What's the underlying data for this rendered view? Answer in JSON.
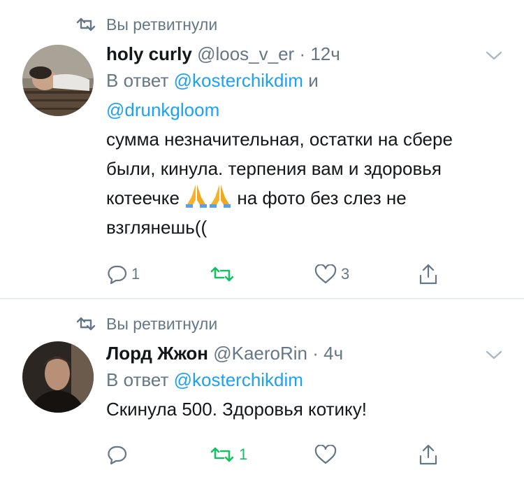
{
  "tweets": [
    {
      "retweet_label": "Вы ретвитнули",
      "name": "holy curly",
      "handle": "@loos_v_er",
      "separator": "·",
      "time": "12ч",
      "reply_prefix": "В ответ",
      "mentions": [
        "@kosterchikdim",
        "@drunkgloom"
      ],
      "mention_joiner": "и",
      "text_part1": "сумма незначительная, остатки на сбере были, кинула. терпения вам и здоровья котеечке",
      "emoji": "🙏🙏",
      "text_part2": "на фото без слез не взглянешь((",
      "reply_count": "1",
      "retweet_count": "",
      "like_count": "3",
      "retweeted": true
    },
    {
      "retweet_label": "Вы ретвитнули",
      "name": "Лорд Жжон",
      "handle": "@KaeroRin",
      "separator": "·",
      "time": "4ч",
      "reply_prefix": "В ответ",
      "mentions": [
        "@kosterchikdim"
      ],
      "text": "Скинула 500. Здоровья котику!",
      "reply_count": "",
      "retweet_count": "1",
      "like_count": "",
      "retweeted": true
    }
  ],
  "colors": {
    "accent": "#1da1f2",
    "retweet_green": "#17bf63",
    "muted": "#657786",
    "text": "#14171a",
    "divider": "#e6ecf0"
  },
  "icons": {
    "retweet": "retweet-icon",
    "reply": "reply-icon",
    "like": "heart-icon",
    "share": "share-icon",
    "menu": "chevron-down-icon"
  }
}
